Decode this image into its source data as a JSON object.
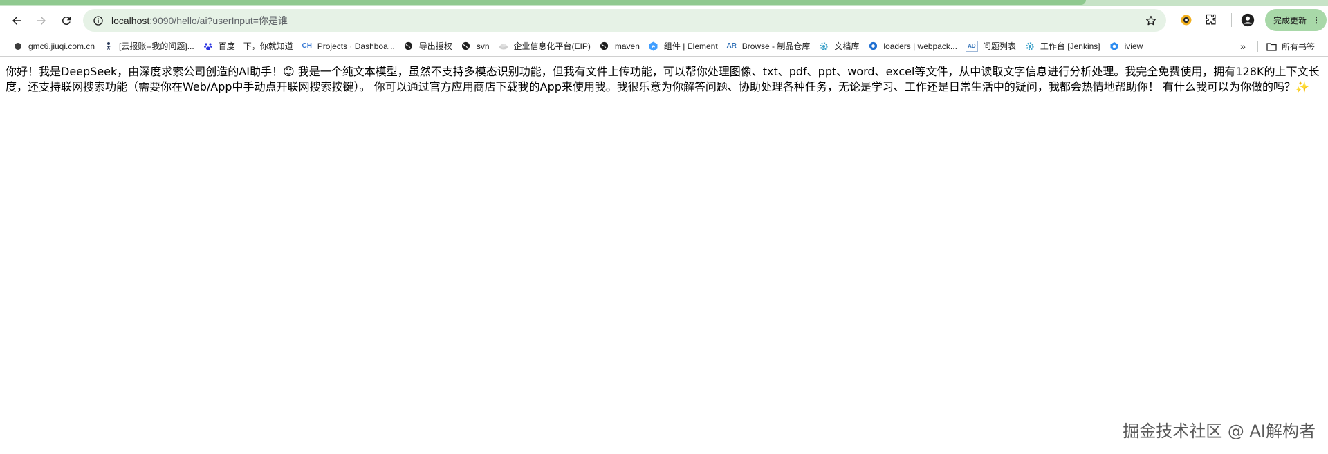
{
  "browser": {
    "address_bar": {
      "host": "localhost",
      "rest": ":9090/hello/ai?userInput=你是谁"
    },
    "update_button_label": "完成更新",
    "icons": {
      "back": "back-arrow-icon",
      "forward": "forward-arrow-icon",
      "reload": "reload-icon",
      "site_info": "site-info-icon",
      "star": "bookmark-star-icon",
      "extension": "extension-icon",
      "puzzle": "puzzle-icon",
      "profile": "profile-icon"
    },
    "colors": {
      "tabstrip": "#c7e3c7",
      "omnibox": "#e6f2e6",
      "update_button": "#a8d8a8"
    }
  },
  "bookmarks": {
    "items": [
      {
        "label": "gmc6.jiuqi.com.cn",
        "icon": "circle-icon"
      },
      {
        "label": "[云报账--我的问题]...",
        "icon": "figure-icon"
      },
      {
        "label": "百度一下，你就知道",
        "icon": "baidu-paw-icon"
      },
      {
        "label": "Projects · Dashboa...",
        "icon": "ch-logo-icon",
        "icon_text": "CH"
      },
      {
        "label": "导出授权",
        "icon": "globe-icon"
      },
      {
        "label": "svn",
        "icon": "globe-icon"
      },
      {
        "label": "企业信息化平台(EIP)",
        "icon": "cloud-icon"
      },
      {
        "label": "maven",
        "icon": "globe-icon"
      },
      {
        "label": "组件 | Element",
        "icon": "element-logo-icon"
      },
      {
        "label": "Browse - 制品仓库",
        "icon": "ar-logo-icon",
        "icon_text": "AR"
      },
      {
        "label": "文档库",
        "icon": "gear-icon"
      },
      {
        "label": "loaders | webpack...",
        "icon": "webpack-icon"
      },
      {
        "label": "问题列表",
        "icon": "ad-logo-icon",
        "icon_text": "AD"
      },
      {
        "label": "工作台 [Jenkins]",
        "icon": "gear-icon"
      },
      {
        "label": "iview",
        "icon": "iview-logo-icon"
      }
    ],
    "more_label": "»",
    "all_bookmarks_label": "所有书签"
  },
  "page": {
    "response_text": "你好！我是DeepSeek，由深度求索公司创造的AI助手！😊 我是一个纯文本模型，虽然不支持多模态识别功能，但我有文件上传功能，可以帮你处理图像、txt、pdf、ppt、word、excel等文件，从中读取文字信息进行分析处理。我完全免费使用，拥有128K的上下文长度，还支持联网搜索功能（需要你在Web/App中手动点开联网搜索按键）。 你可以通过官方应用商店下载我的App来使用我。我很乐意为你解答问题、协助处理各种任务，无论是学习、工作还是日常生活中的疑问，我都会热情地帮助你！ 有什么我可以为你做的吗？✨"
  },
  "watermark": "掘金技术社区 @ AI解构者"
}
